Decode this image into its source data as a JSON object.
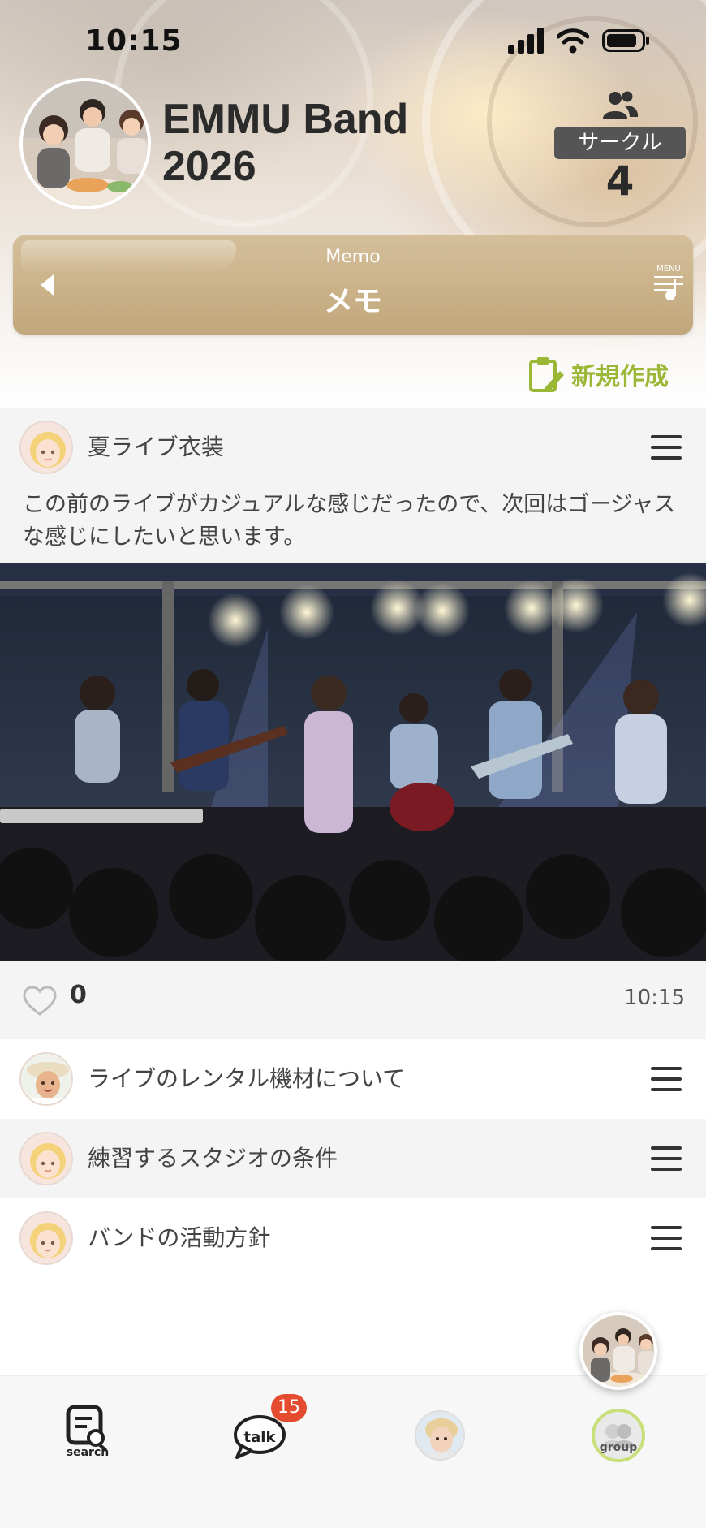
{
  "status_bar": {
    "time": "10:15"
  },
  "header": {
    "title_line1": "EMMU Band",
    "title_line2": "2026",
    "circle_label": "サークル",
    "circle_count": "4"
  },
  "memo_bar": {
    "subtitle": "Memo",
    "title": "メモ",
    "menu_caption": "MENU"
  },
  "new_button": {
    "label": "新規作成"
  },
  "post": {
    "title": "夏ライブ衣装",
    "body": "この前のライブがカジュアルな感じだったので、次回はゴージャスな感じにしたいと思います。",
    "likes": "0",
    "time": "10:15"
  },
  "memo_list": [
    {
      "title": "ライブのレンタル機材について"
    },
    {
      "title": "練習するスタジオの条件"
    },
    {
      "title": "バンドの活動方針"
    }
  ],
  "tabbar": {
    "search_caption": "search",
    "talk_caption": "talk",
    "talk_badge": "15",
    "group_caption": "group"
  },
  "colors": {
    "accent_gold": "#c9b086",
    "new_green": "#9ab735",
    "badge_red": "#e44b2f"
  }
}
